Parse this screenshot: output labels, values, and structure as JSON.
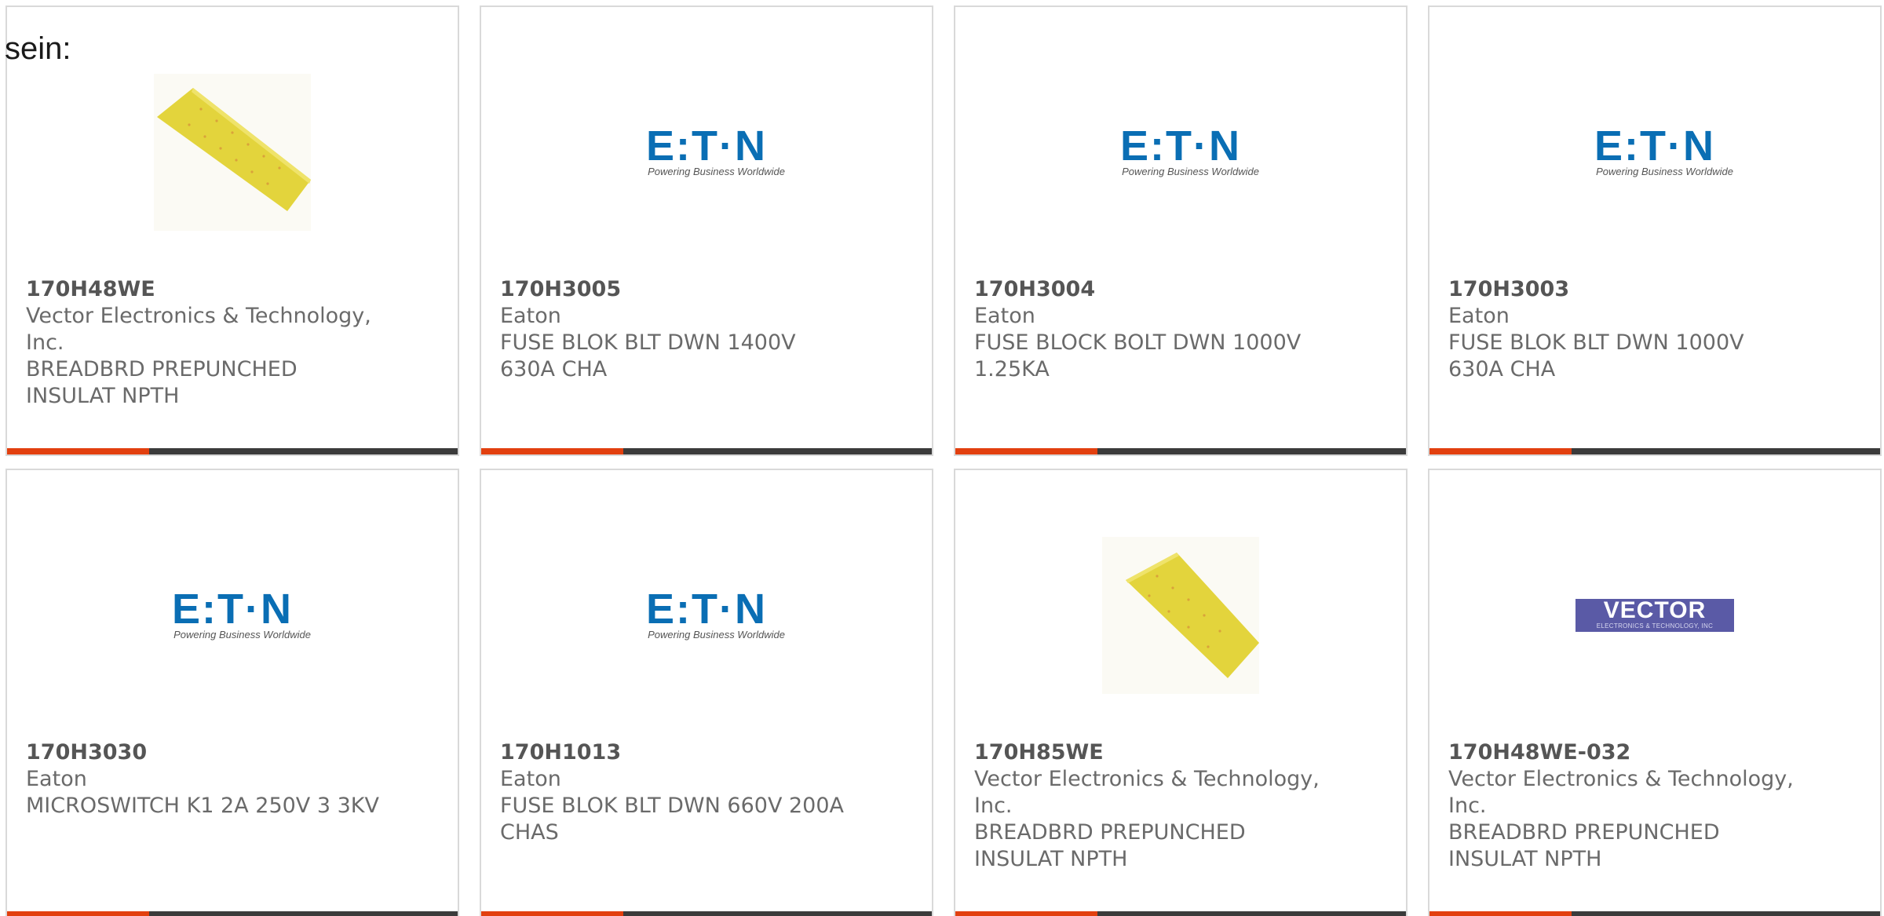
{
  "intro_text": "sein:",
  "colors": {
    "accent_bar": "#e2400f",
    "dark_bar": "#3b3b3b",
    "eaton_blue": "#0a6eb4",
    "vector_purple": "#5a5aa6",
    "board_yellow": "#e3d43c"
  },
  "products": [
    {
      "part": "170H48WE",
      "manufacturer": "Vector Electronics & Technology, Inc.",
      "description": "BREADBRD PREPUNCHED INSULAT NPTH",
      "image": "breadboard-image"
    },
    {
      "part": "170H3005",
      "manufacturer": "Eaton",
      "description": "FUSE BLOK BLT DWN 1400V 630A CHA",
      "image": "eaton-logo"
    },
    {
      "part": "170H3004",
      "manufacturer": "Eaton",
      "description": "FUSE BLOCK BOLT DWN 1000V 1.25KA",
      "image": "eaton-logo"
    },
    {
      "part": "170H3003",
      "manufacturer": "Eaton",
      "description": "FUSE BLOK BLT DWN 1000V 630A CHA",
      "image": "eaton-logo"
    },
    {
      "part": "170H3030",
      "manufacturer": "Eaton",
      "description": "MICROSWITCH K1 2A 250V 3 3KV",
      "image": "eaton-logo"
    },
    {
      "part": "170H1013",
      "manufacturer": "Eaton",
      "description": "FUSE BLOK BLT DWN 660V 200A CHAS",
      "image": "eaton-logo"
    },
    {
      "part": "170H85WE",
      "manufacturer": "Vector Electronics & Technology, Inc.",
      "description": "BREADBRD PREPUNCHED INSULAT NPTH",
      "image": "breadboard-image"
    },
    {
      "part": "170H48WE-032",
      "manufacturer": "Vector Electronics & Technology, Inc.",
      "description": "BREADBRD PREPUNCHED INSULAT NPTH",
      "image": "vector-logo"
    }
  ],
  "logos": {
    "eaton_word": "E:T·N",
    "eaton_tagline": "Powering Business Worldwide",
    "vector_word": "VECTOR",
    "vector_sub": "ELECTRONICS & TECHNOLOGY, INC"
  }
}
